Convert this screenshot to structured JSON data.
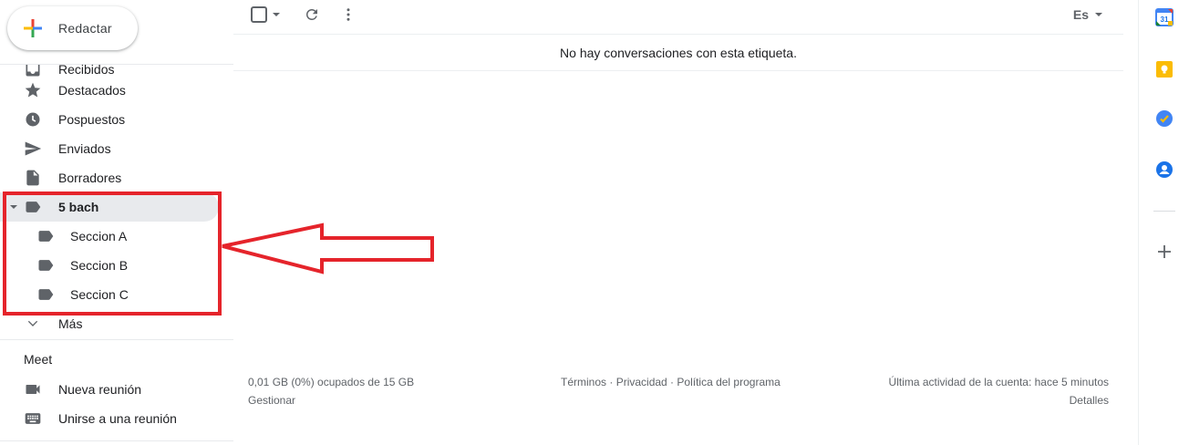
{
  "compose": {
    "label": "Redactar"
  },
  "nav": {
    "partial_label": "Recibidos",
    "items": [
      {
        "label": "Destacados",
        "icon": "star-icon"
      },
      {
        "label": "Pospuestos",
        "icon": "clock-icon"
      },
      {
        "label": "Enviados",
        "icon": "send-icon"
      },
      {
        "label": "Borradores",
        "icon": "draft-icon"
      }
    ],
    "label_parent": {
      "label": "5 bach",
      "icon": "label-icon",
      "expanded": true
    },
    "sublabels": [
      {
        "label": "Seccion A",
        "icon": "label-icon"
      },
      {
        "label": "Seccion B",
        "icon": "label-icon"
      },
      {
        "label": "Seccion C",
        "icon": "label-icon"
      }
    ],
    "more_label": "Más"
  },
  "meet": {
    "title": "Meet",
    "new_meeting": "Nueva reunión",
    "join_meeting": "Unirse a una reunión"
  },
  "toolbar": {
    "language": "Es"
  },
  "main": {
    "empty_message": "No hay conversaciones con esta etiqueta."
  },
  "footer": {
    "storage": "0,01 GB (0%) ocupados de 15 GB",
    "manage": "Gestionar",
    "terms": "Términos",
    "privacy": "Privacidad",
    "program_policy": "Política del programa",
    "separator": " · ",
    "last_activity": "Última actividad de la cuenta: hace 5 minutos",
    "details": "Detalles"
  },
  "side_panel": {
    "calendar_day": "31",
    "apps": [
      "calendar-icon",
      "keep-icon",
      "tasks-icon",
      "contacts-icon",
      "add-icon"
    ]
  },
  "colors": {
    "annotation_red": "#e5242b",
    "active_bg": "#e8eaed",
    "icon_gray": "#5f6368"
  }
}
